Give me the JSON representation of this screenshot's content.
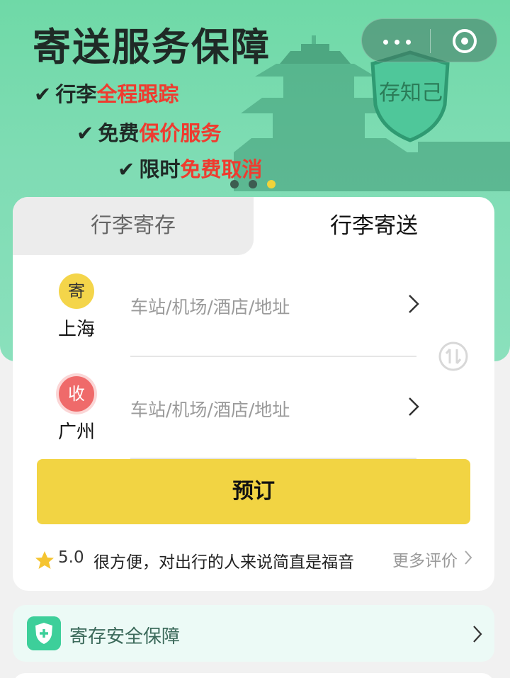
{
  "banner": {
    "headline": "寄送服务保障",
    "features": [
      {
        "prefix": "行李",
        "highlight": "全程跟踪",
        "suffix": ""
      },
      {
        "prefix": "免费",
        "highlight": "保价服务",
        "suffix": ""
      },
      {
        "prefix": "限时",
        "highlight": "免费取消",
        "suffix": ""
      }
    ],
    "shield_text": "存知己",
    "pager": {
      "count": 3,
      "active_index": 2
    }
  },
  "colors": {
    "accent_yellow": "#f2d443",
    "banner_green": "#6fd9a7",
    "highlight_red": "#ef3b2f"
  },
  "tabs": {
    "storage": "行李寄存",
    "delivery": "行李寄送",
    "active": "delivery"
  },
  "route": {
    "from": {
      "badge": "寄",
      "city": "上海",
      "placeholder": "车站/机场/酒店/地址"
    },
    "to": {
      "badge": "收",
      "city": "广州",
      "placeholder": "车站/机场/酒店/地址"
    }
  },
  "book_button": "预订",
  "review": {
    "score": "5.0",
    "text": "很方便，对出行的人来说简直是福音",
    "more": "更多评价"
  },
  "safety": {
    "label": "寄存安全保障"
  }
}
